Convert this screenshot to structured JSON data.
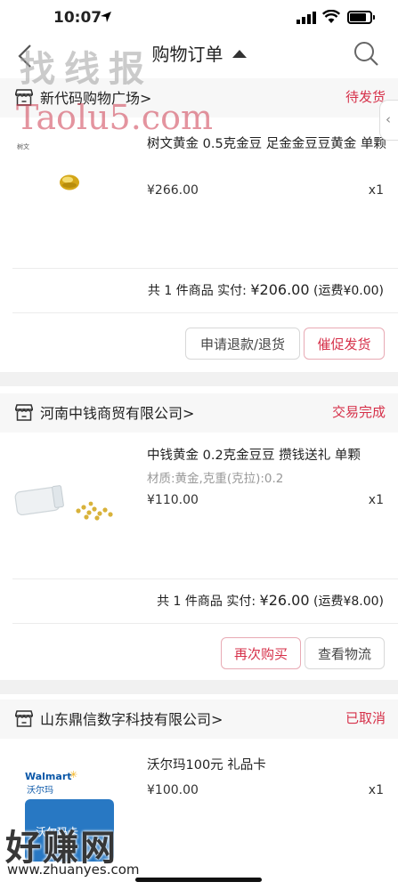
{
  "status_bar": {
    "time": "10:07"
  },
  "nav": {
    "title": "购物订单"
  },
  "orders": [
    {
      "shop": "新代码购物广场>",
      "status": "待发货",
      "product_title": "树文黄金 0.5克金豆 足金金豆豆黄金 单颗",
      "spec": "",
      "price": "¥266.00",
      "qty": "x1",
      "summary_prefix": "共 1 件商品  实付:",
      "paid": "¥206.00",
      "shipping": "(运费¥0.00)",
      "buttons": [
        "申请退款/退货",
        "催促发货"
      ]
    },
    {
      "shop": "河南中钱商贸有限公司>",
      "status": "交易完成",
      "product_title": "中钱黄金 0.2克金豆豆 攒钱送礼 单颗",
      "spec": "材质:黄金,克重(克拉):0.2",
      "price": "¥110.00",
      "qty": "x1",
      "summary_prefix": "共 1 件商品  实付:",
      "paid": "¥26.00",
      "shipping": "(运费¥8.00)",
      "buttons": [
        "再次购买",
        "查看物流"
      ]
    },
    {
      "shop": "山东鼎信数字科技有限公司>",
      "status": "已取消",
      "product_title": "沃尔玛100元 礼品卡",
      "spec": "",
      "price": "¥100.00",
      "qty": "x1",
      "thumb_brand": "Walmart",
      "thumb_brand_cn": "沃尔玛",
      "thumb_card_text": "沃尔玛卡"
    }
  ],
  "watermarks": {
    "top": "找线报",
    "sub": "Taolu5.com",
    "bottom": "好赚网",
    "url": "www.zhuanyes.com"
  },
  "colors": {
    "accent": "#d6314a",
    "page_bg": "#f1f1f1",
    "header_bg": "#f7f7f7"
  }
}
